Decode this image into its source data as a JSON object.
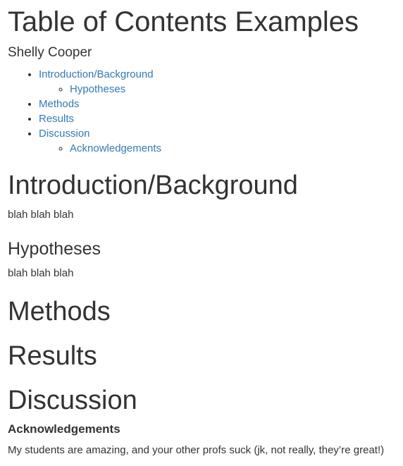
{
  "document": {
    "title": "Table of Contents Examples",
    "author": "Shelly Cooper"
  },
  "toc": {
    "items": [
      {
        "label": "Introduction/Background",
        "children": [
          {
            "label": "Hypotheses"
          }
        ]
      },
      {
        "label": "Methods"
      },
      {
        "label": "Results"
      },
      {
        "label": "Discussion",
        "children": [
          {
            "label": "Acknowledgements"
          }
        ]
      }
    ],
    "link_color": "#337ab7"
  },
  "sections": {
    "introduction": {
      "heading": "Introduction/Background",
      "text": "blah blah blah"
    },
    "hypotheses": {
      "heading": "Hypotheses",
      "text": "blah blah blah"
    },
    "methods": {
      "heading": "Methods"
    },
    "results": {
      "heading": "Results"
    },
    "discussion": {
      "heading": "Discussion"
    },
    "acknowledgements": {
      "heading": "Acknowledgements",
      "text": "My students are amazing, and your other profs suck (jk, not really, they’re great!)"
    }
  }
}
